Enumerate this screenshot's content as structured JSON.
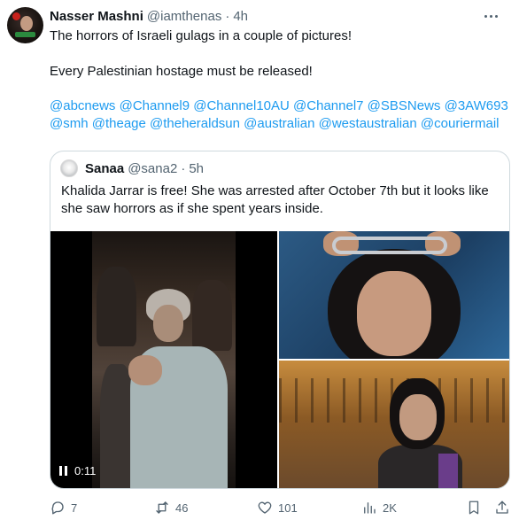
{
  "tweet": {
    "author_name": "Nasser Mashni",
    "author_handle": "@iamthenas",
    "separator": "·",
    "time": "4h",
    "text_line1": "The horrors of Israeli gulags in a couple of pictures!",
    "text_line2": "Every Palestinian hostage must be released!",
    "mentions": [
      "@abcnews",
      "@Channel9",
      "@Channel10AU",
      "@Channel7",
      "@SBSNews",
      "@3AW693",
      "@smh",
      "@theage",
      "@theheraldsun",
      "@australian",
      "@westaustralian",
      "@couriermail"
    ]
  },
  "quote": {
    "author_name": "Sanaa",
    "author_handle": "@sana2",
    "separator": "·",
    "time": "5h",
    "text": "Khalida Jarrar is free! She was arrested after October 7th but it looks like she saw horrors as if she spent years inside.",
    "video_time": "0:11"
  },
  "actions": {
    "replies": "7",
    "reposts": "46",
    "likes": "101",
    "views": "2K"
  },
  "icons": {
    "more": "more-horizontal-icon",
    "reply": "reply-icon",
    "repost": "repost-icon",
    "like": "heart-icon",
    "views": "views-chart-icon",
    "bookmark": "bookmark-icon",
    "share": "share-icon",
    "pause": "pause-icon"
  },
  "colors": {
    "link": "#1d9bf0",
    "secondary": "#536471",
    "text": "#0f1419",
    "border": "#cfd9de"
  }
}
